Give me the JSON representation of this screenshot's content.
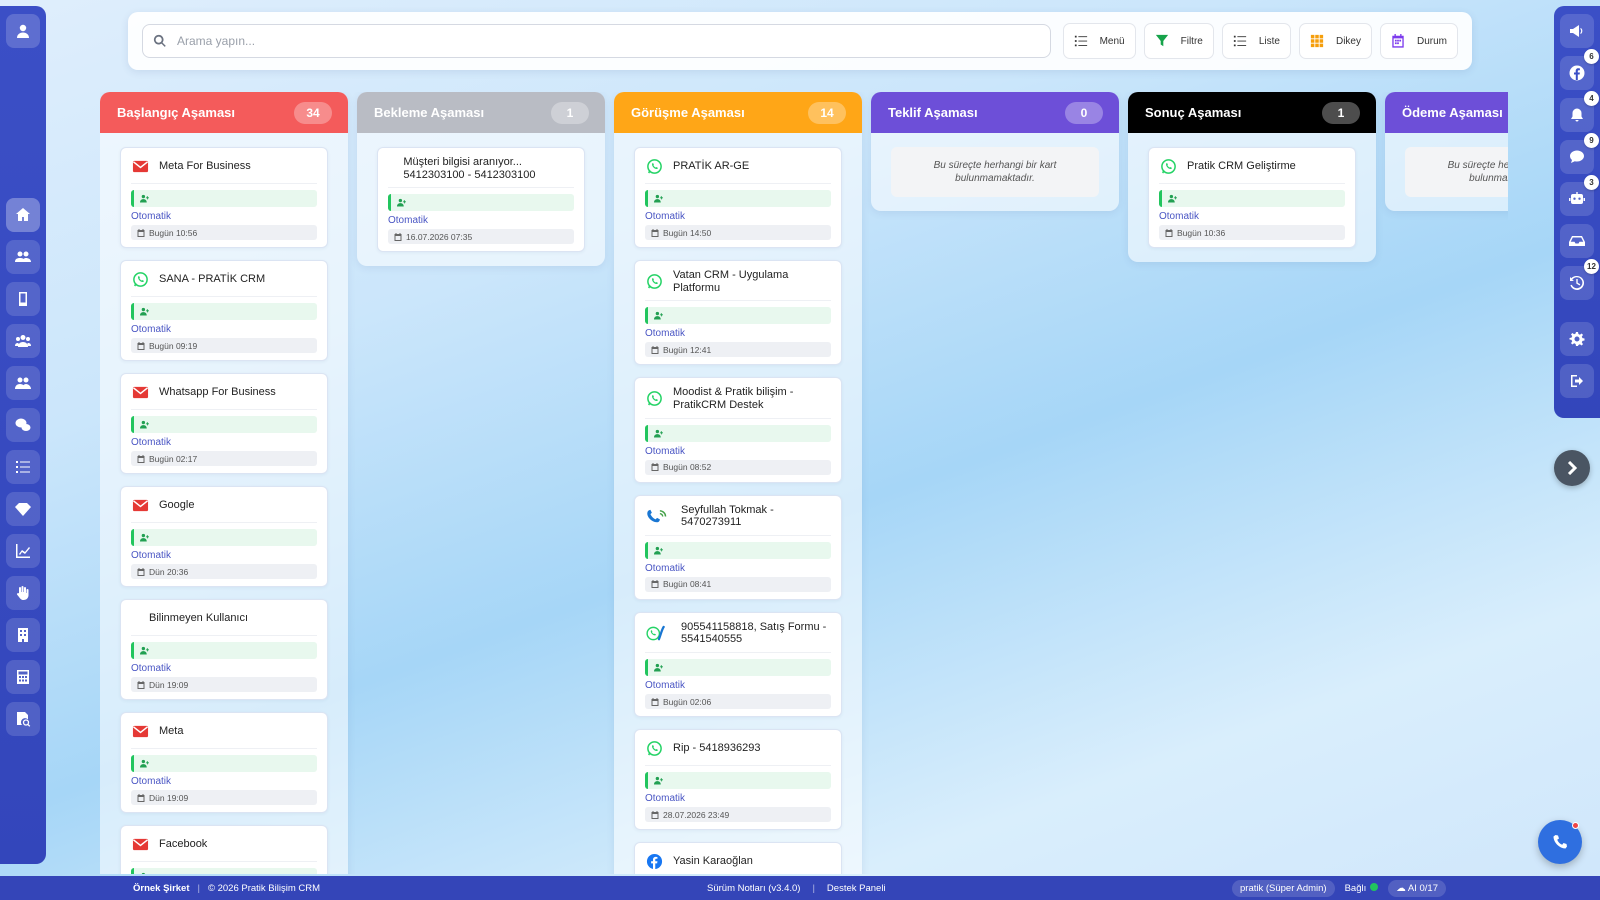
{
  "toolbar": {
    "search_placeholder": "Arama yapın...",
    "buttons": [
      {
        "label": "Menü",
        "icon": "list-icon",
        "color": "#333333"
      },
      {
        "label": "Filtre",
        "icon": "filter-icon",
        "color": "#16a34a"
      },
      {
        "label": "Liste",
        "icon": "list-icon",
        "color": "#333333"
      },
      {
        "label": "Dikey",
        "icon": "grid-icon",
        "color": "#f59e0b"
      },
      {
        "label": "Durum",
        "icon": "calendar-icon",
        "color": "#7c3aed"
      }
    ]
  },
  "left_sidebar": {
    "items": [
      "home-icon",
      "users-icon",
      "mobile-icon",
      "user-group-icon",
      "team-icon",
      "chat-bubbles-icon",
      "task-list-icon",
      "diamond-icon",
      "chart-icon",
      "hand-icon",
      "building-icon",
      "calculator-icon",
      "report-search-icon"
    ]
  },
  "right_sidebar": {
    "items": [
      {
        "icon": "megaphone-icon",
        "badge": ""
      },
      {
        "icon": "facebook-icon",
        "badge": "6"
      },
      {
        "icon": "bell-icon",
        "badge": "4"
      },
      {
        "icon": "chat-icon",
        "badge": "9"
      },
      {
        "icon": "robot-icon",
        "badge": "3"
      },
      {
        "icon": "inbox-icon",
        "badge": ""
      },
      {
        "icon": "history-icon",
        "badge": "12"
      }
    ],
    "bottom_items": [
      "gear-icon",
      "logout-icon"
    ]
  },
  "board": {
    "empty_text": "Bu süreçte herhangi bir kart bulunmamaktadır.",
    "columns": [
      {
        "title": "Başlangıç Aşaması",
        "count": "34",
        "color": "#f45b5b",
        "cards": [
          {
            "title": "Meta For Business",
            "icon": "mail-icon",
            "auto": "Otomatik",
            "date": "Bugün 10:56"
          },
          {
            "title": "SANA - PRATİK CRM",
            "icon": "whatsapp-icon",
            "auto": "Otomatik",
            "date": "Bugün 09:19"
          },
          {
            "title": "Whatsapp For Business",
            "icon": "mail-icon",
            "auto": "Otomatik",
            "date": "Bugün 02:17"
          },
          {
            "title": "Google",
            "icon": "mail-icon",
            "auto": "Otomatik",
            "date": "Dün 20:36"
          },
          {
            "title": "Bilinmeyen Kullanıcı",
            "icon": "",
            "auto": "Otomatik",
            "date": "Dün 19:09"
          },
          {
            "title": "Meta",
            "icon": "mail-icon",
            "auto": "Otomatik",
            "date": "Dün 19:09"
          },
          {
            "title": "Facebook",
            "icon": "mail-icon",
            "auto": "",
            "date": ""
          }
        ]
      },
      {
        "title": "Bekleme Aşaması",
        "count": "1",
        "color": "#b9bcc4",
        "cards": [
          {
            "title": "Müşteri bilgisi aranıyor... 5412303100 - 5412303100",
            "icon": "",
            "auto": "Otomatik",
            "date": "16.07.2026 07:35"
          }
        ]
      },
      {
        "title": "Görüşme Aşaması",
        "count": "14",
        "color": "#ffa617",
        "cards": [
          {
            "title": "PRATİK AR-GE",
            "icon": "whatsapp-icon",
            "auto": "Otomatik",
            "date": "Bugün 14:50"
          },
          {
            "title": "Vatan CRM - Uygulama Platformu",
            "icon": "whatsapp-icon",
            "auto": "Otomatik",
            "date": "Bugün 12:41"
          },
          {
            "title": "Moodist & Pratik bilişim - PratikCRM Destek",
            "icon": "whatsapp-icon",
            "auto": "Otomatik",
            "date": "Bugün 08:52"
          },
          {
            "title": "Seyfullah Tokmak - 5470273911",
            "icon": "phone-icon",
            "auto": "Otomatik",
            "date": "Bugün 08:41"
          },
          {
            "title": "905541158818, Satış Formu - 5541540555",
            "icon": "whatsapp-phone-icon",
            "auto": "Otomatik",
            "date": "Bugün 02:06"
          },
          {
            "title": "Rip - 5418936293",
            "icon": "whatsapp-icon",
            "auto": "Otomatik",
            "date": "28.07.2026 23:49"
          },
          {
            "title": "Yasin Karaoğlan",
            "icon": "facebook-icon",
            "auto": "",
            "date": ""
          }
        ]
      },
      {
        "title": "Teklif Aşaması",
        "count": "0",
        "color": "#6d4fd8",
        "cards": []
      },
      {
        "title": "Sonuç Aşaması",
        "count": "1",
        "color": "#000000",
        "cards": [
          {
            "title": "Pratik CRM Geliştirme",
            "icon": "whatsapp-icon",
            "auto": "Otomatik",
            "date": "Bugün 10:36"
          }
        ]
      },
      {
        "title": "Ödeme Aşaması",
        "count": "",
        "color": "#6d4fd8",
        "cards": []
      }
    ]
  },
  "footer": {
    "company": "Örnek Şirket",
    "copyright": "© 2026 Pratik Bilişim CRM",
    "release_notes": "Sürüm Notları (v3.4.0)",
    "support": "Destek Paneli",
    "user": "pratik (Süper Admin)",
    "status": "Bağlı",
    "ai": "AI 0/17"
  }
}
